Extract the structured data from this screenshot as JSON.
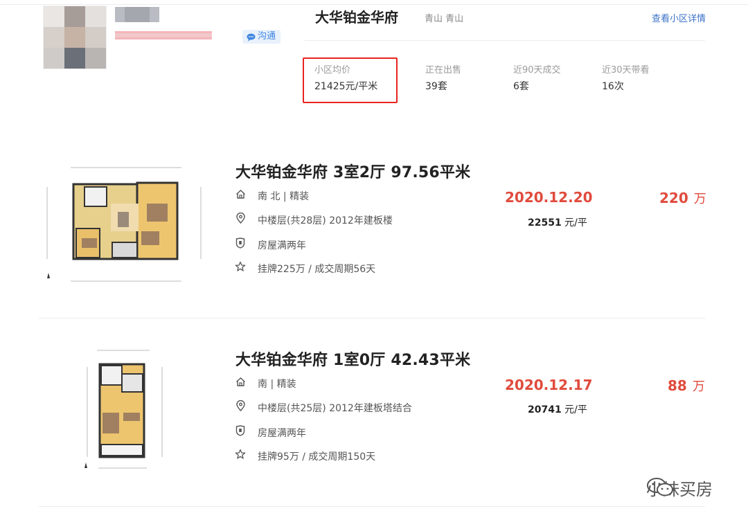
{
  "agent": {
    "chat_label": "沟通"
  },
  "community": {
    "name": "大华铂金华府",
    "district": "青山 青山",
    "detail_link": "查看小区详情",
    "stats": [
      {
        "label": "小区均价",
        "value": "21425元/平米"
      },
      {
        "label": "正在出售",
        "value": "39套"
      },
      {
        "label": "近90天成交",
        "value": "6套"
      },
      {
        "label": "近30天带看",
        "value": "16次"
      }
    ]
  },
  "listings": [
    {
      "title": "大华铂金华府 3室2厅 97.56平米",
      "orientation": "南 北 | 精装",
      "floor": "中楼层(共28层) 2012年建板楼",
      "tag": "房屋满两年",
      "history": "挂牌225万 / 成交周期56天",
      "deal_date": "2020.12.20",
      "unit_price": "22551",
      "unit_price_suffix": "元/平",
      "total_price": "220",
      "total_unit": "万"
    },
    {
      "title": "大华铂金华府 1室0厅 42.43平米",
      "orientation": "南 | 精装",
      "floor": "中楼层(共25层) 2012年建板塔结合",
      "tag": "房屋满两年",
      "history": "挂牌95万 / 成交周期150天",
      "deal_date": "2020.12.17",
      "unit_price": "20741",
      "unit_price_suffix": "元/平",
      "total_price": "88",
      "total_unit": "万"
    }
  ],
  "watermark": {
    "text": "小妹买房",
    "icon": "wechat-icon"
  },
  "colors": {
    "accent_red": "#e04b3d",
    "link_blue": "#3b72c8",
    "highlight_box": "#e8231f"
  }
}
